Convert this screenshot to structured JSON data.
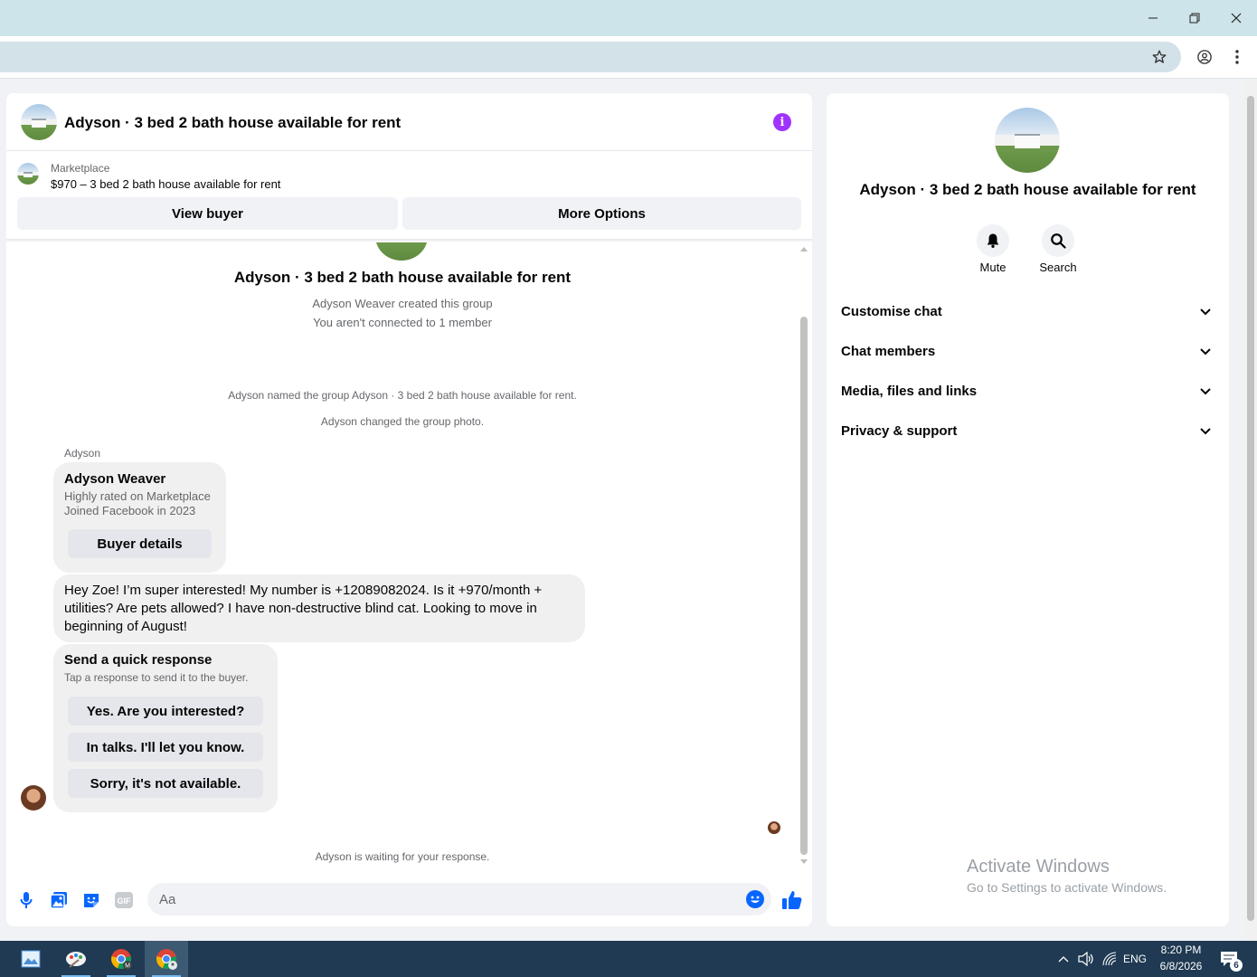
{
  "browser": {
    "minimize_icon": "minimize-icon",
    "restore_icon": "restore-icon",
    "close_icon": "close-icon",
    "bookmark_icon": "star-icon",
    "profile_icon": "profile-icon",
    "menu_icon": "kebab-menu-icon"
  },
  "chat": {
    "title": "Adyson · 3 bed 2 bath house available for rent",
    "marketplace_label": "Marketplace",
    "listing": "$970 – 3 bed 2 bath house available for rent",
    "view_buyer": "View buyer",
    "more_options": "More Options",
    "group_title": "Adyson · 3 bed 2 bath house available for rent",
    "created_by": "Adyson Weaver created this group",
    "not_connected": "You aren't connected to 1 member",
    "named_event": "Adyson named the group Adyson · 3 bed 2 bath house available for rent.",
    "photo_event": "Adyson changed the group photo.",
    "sender_name": "Adyson",
    "profile_card": {
      "name": "Adyson Weaver",
      "line1": "Highly rated on Marketplace",
      "line2": "Joined Facebook in 2023",
      "button": "Buyer details"
    },
    "message": "Hey Zoe! I’m super interested! My number is +12089082024. Is it +970/month + utilities? Are pets allowed? I have non-destructive blind cat. Looking to move in beginning of August!",
    "quick_response": {
      "title": "Send a quick response",
      "subtitle": "Tap a response to send it to the buyer.",
      "options": [
        "Yes. Are you interested?",
        "In talks. I'll let you know.",
        "Sorry, it's not available."
      ]
    },
    "waiting": "Adyson is waiting for your response.",
    "composer_placeholder": "Aa"
  },
  "info": {
    "title": "Adyson · 3 bed 2 bath house available for rent",
    "mute": "Mute",
    "search": "Search",
    "sections": [
      "Customise chat",
      "Chat members",
      "Media, files and links",
      "Privacy & support"
    ]
  },
  "watermark": {
    "line1": "Activate Windows",
    "line2": "Go to Settings to activate Windows."
  },
  "taskbar": {
    "lang": "ENG",
    "time": "8:20 PM",
    "date": "6/8/2026",
    "notifications": "6"
  },
  "colors": {
    "accent_blue": "#0866ff",
    "info_purple": "#a033ff",
    "titlebar": "#cde4ea",
    "taskbar": "#1f3a52"
  }
}
